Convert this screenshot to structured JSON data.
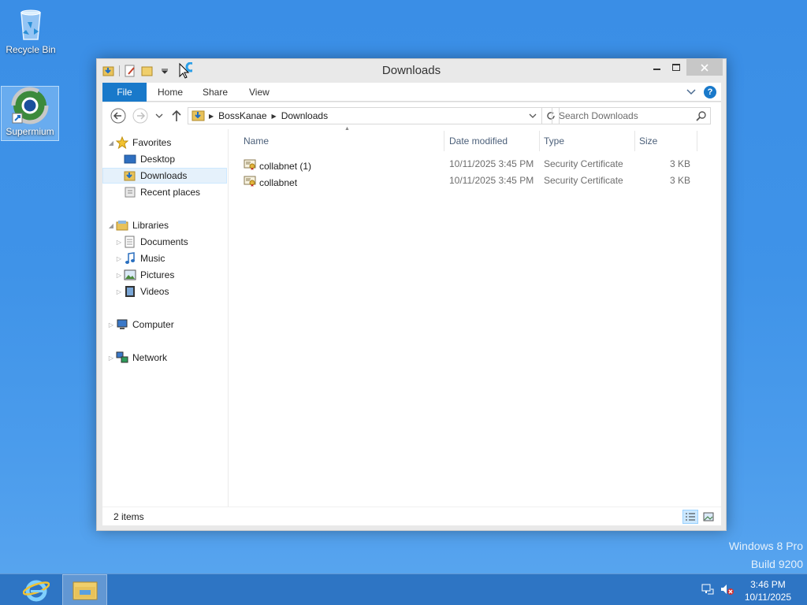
{
  "desktop": {
    "icons": [
      {
        "label": "Recycle Bin"
      },
      {
        "label": "Supermium"
      }
    ],
    "watermark": {
      "line1": "Windows 8 Pro",
      "line2": "Build 9200"
    }
  },
  "window": {
    "title": "Downloads",
    "ribbon": {
      "tabs": [
        "File",
        "Home",
        "Share",
        "View"
      ],
      "help": "?"
    },
    "address": {
      "crumbs": [
        "BossKanae",
        "Downloads"
      ]
    },
    "search": {
      "placeholder": "Search Downloads"
    },
    "nav": {
      "favorites": {
        "label": "Favorites",
        "items": [
          "Desktop",
          "Downloads",
          "Recent places"
        ]
      },
      "libraries": {
        "label": "Libraries",
        "items": [
          "Documents",
          "Music",
          "Pictures",
          "Videos"
        ]
      },
      "computer": "Computer",
      "network": "Network"
    },
    "columns": {
      "name": "Name",
      "date": "Date modified",
      "type": "Type",
      "size": "Size"
    },
    "files": [
      {
        "name": "collabnet (1)",
        "date": "10/11/2025 3:45 PM",
        "type": "Security Certificate",
        "size": "3 KB"
      },
      {
        "name": "collabnet",
        "date": "10/11/2025 3:45 PM",
        "type": "Security Certificate",
        "size": "3 KB"
      }
    ],
    "status": {
      "count": "2 items"
    }
  },
  "taskbar": {
    "clock": {
      "time": "3:46 PM",
      "date": "10/11/2025"
    }
  },
  "colors": {
    "accent": "#1979ca",
    "desktop": "#3f93e8"
  }
}
